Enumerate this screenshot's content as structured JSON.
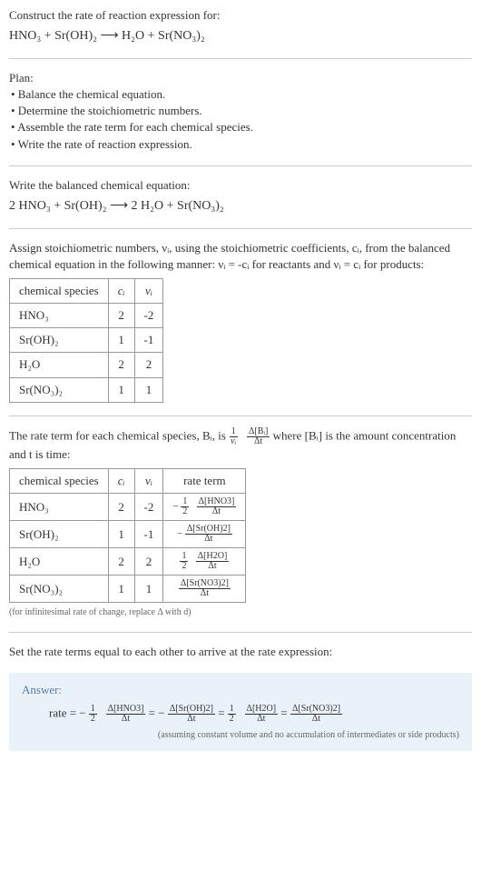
{
  "intro": {
    "line1": "Construct the rate of reaction expression for:",
    "equation": "HNO₃ + Sr(OH)₂ ⟶ H₂O + Sr(NO₃)₂"
  },
  "plan": {
    "title": "Plan:",
    "items": [
      "• Balance the chemical equation.",
      "• Determine the stoichiometric numbers.",
      "• Assemble the rate term for each chemical species.",
      "• Write the rate of reaction expression."
    ]
  },
  "balanced": {
    "title": "Write the balanced chemical equation:",
    "equation": "2 HNO₃ + Sr(OH)₂ ⟶ 2 H₂O + Sr(NO₃)₂"
  },
  "assign": {
    "text": "Assign stoichiometric numbers, νᵢ, using the stoichiometric coefficients, cᵢ, from the balanced chemical equation in the following manner: νᵢ = -cᵢ for reactants and νᵢ = cᵢ for products:"
  },
  "table1": {
    "headers": [
      "chemical species",
      "cᵢ",
      "νᵢ"
    ],
    "rows": [
      {
        "species": "HNO₃",
        "c": "2",
        "v": "-2"
      },
      {
        "species": "Sr(OH)₂",
        "c": "1",
        "v": "-1"
      },
      {
        "species": "H₂O",
        "c": "2",
        "v": "2"
      },
      {
        "species": "Sr(NO₃)₂",
        "c": "1",
        "v": "1"
      }
    ]
  },
  "rateterm": {
    "pre": "The rate term for each chemical species, Bᵢ, is ",
    "post": " where [Bᵢ] is the amount concentration and t is time:"
  },
  "table2": {
    "headers": [
      "chemical species",
      "cᵢ",
      "νᵢ",
      "rate term"
    ],
    "rows": [
      {
        "species": "HNO₃",
        "c": "2",
        "v": "-2",
        "rate_prefix": "−",
        "rate_half": true,
        "rate_delta": "Δ[HNO3]"
      },
      {
        "species": "Sr(OH)₂",
        "c": "1",
        "v": "-1",
        "rate_prefix": "−",
        "rate_half": false,
        "rate_delta": "Δ[Sr(OH)2]"
      },
      {
        "species": "H₂O",
        "c": "2",
        "v": "2",
        "rate_prefix": "",
        "rate_half": true,
        "rate_delta": "Δ[H2O]"
      },
      {
        "species": "Sr(NO₃)₂",
        "c": "1",
        "v": "1",
        "rate_prefix": "",
        "rate_half": false,
        "rate_delta": "Δ[Sr(NO3)2]"
      }
    ]
  },
  "note1": "(for infinitesimal rate of change, replace Δ with d)",
  "setequal": "Set the rate terms equal to each other to arrive at the rate expression:",
  "answer": {
    "label": "Answer:",
    "note": "(assuming constant volume and no accumulation of intermediates or side products)"
  },
  "dt": "Δt",
  "half_num": "1",
  "half_den": "2",
  "rate_word": "rate = ",
  "minus": "−",
  "eq": " = ",
  "nu_i": "νᵢ",
  "one": "1",
  "dBi": "Δ[Bᵢ]",
  "d_hno3": "Δ[HNO3]",
  "d_sroh2": "Δ[Sr(OH)2]",
  "d_h2o": "Δ[H2O]",
  "d_srno32": "Δ[Sr(NO3)2]"
}
